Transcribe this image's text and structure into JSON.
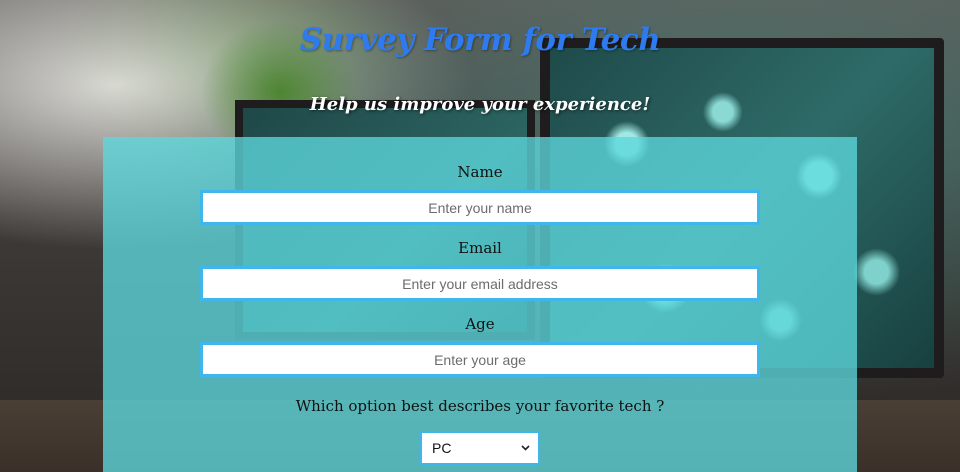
{
  "header": {
    "title": "Survey Form for Tech",
    "subtitle": "Help us improve your experience!"
  },
  "form": {
    "name": {
      "label": "Name",
      "placeholder": "Enter your name"
    },
    "email": {
      "label": "Email",
      "placeholder": "Enter your email address"
    },
    "age": {
      "label": "Age",
      "placeholder": "Enter your age"
    },
    "favorite_tech": {
      "question": "Which option best describes your favorite tech ?",
      "selected": "PC"
    }
  },
  "colors": {
    "title": "#2e7bf0",
    "panel": "#5cd7dc",
    "input_border": "#3fb6ec"
  },
  "icons": {
    "select_chevron": "chevron-down-icon"
  }
}
